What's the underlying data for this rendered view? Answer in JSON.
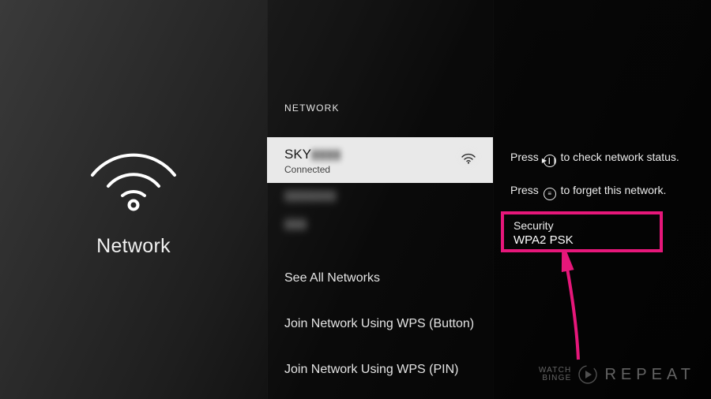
{
  "left": {
    "title": "Network"
  },
  "mid": {
    "header": "NETWORK",
    "selected": {
      "name": "SKY",
      "name_redacted": "▮▮▮▮",
      "status": "Connected"
    },
    "others": [
      "▮▮▮▮▮▮▮",
      "▮▮▮"
    ],
    "actions": {
      "see_all": "See All Networks",
      "wps_button": "Join Network Using WPS (Button)",
      "wps_pin": "Join Network Using WPS (PIN)"
    }
  },
  "right": {
    "tip1_a": "Press ",
    "tip1_glyph": "▶❙❙",
    "tip1_b": " to check network status.",
    "tip2_a": "Press ",
    "tip2_glyph": "≡",
    "tip2_b": " to forget this network.",
    "security_label": "Security",
    "security_value": "WPA2 PSK"
  },
  "watermark": {
    "small1": "WATCH",
    "small2": "BINGE",
    "big": "REPEAT"
  },
  "colors": {
    "highlight": "#e6177a"
  }
}
